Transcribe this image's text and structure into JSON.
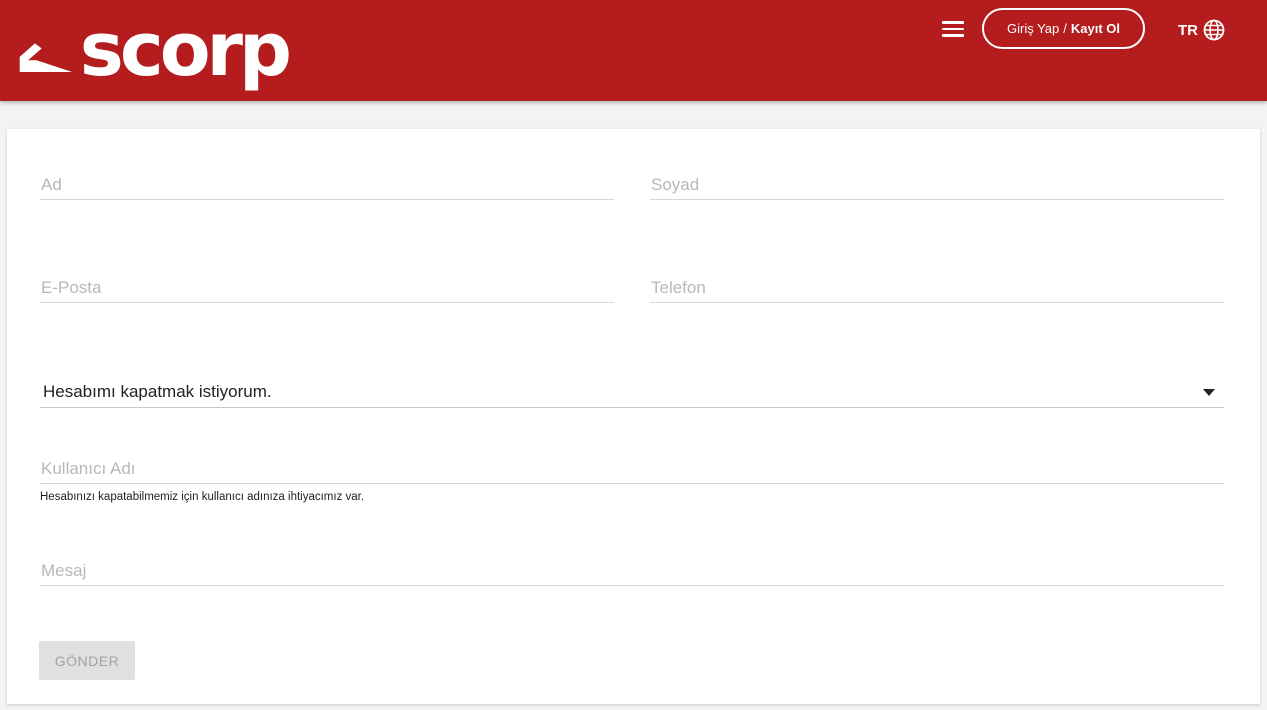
{
  "header": {
    "brand": "scorp",
    "auth": {
      "login_label": "Giriş Yap",
      "separator": "/",
      "register_label": "Kayıt Ol"
    },
    "language": "TR",
    "background_color": "#b41c1e"
  },
  "form": {
    "first_name": {
      "placeholder": "Ad",
      "value": ""
    },
    "last_name": {
      "placeholder": "Soyad",
      "value": ""
    },
    "email": {
      "placeholder": "E-Posta",
      "value": ""
    },
    "phone": {
      "placeholder": "Telefon",
      "value": ""
    },
    "topic": {
      "selected": "Hesabımı kapatmak istiyorum."
    },
    "username": {
      "placeholder": "Kullanıcı Adı",
      "value": "",
      "helper": "Hesabınızı kapatabilmemiz için kullanıcı adınıza ihtiyacımız var."
    },
    "message": {
      "placeholder": "Mesaj",
      "value": ""
    },
    "submit_label": "GÖNDER"
  },
  "icons": [
    "logo-mark-icon",
    "menu-icon",
    "globe-icon",
    "chevron-down-icon"
  ]
}
